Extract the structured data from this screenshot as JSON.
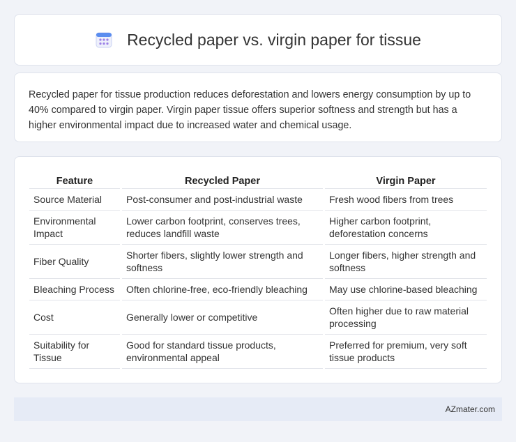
{
  "header": {
    "icon": "calendar-icon",
    "title": "Recycled paper vs. virgin paper for tissue"
  },
  "description": "Recycled paper for tissue production reduces deforestation and lowers energy consumption by up to 40% compared to virgin paper. Virgin paper tissue offers superior softness and strength but has a higher environmental impact due to increased water and chemical usage.",
  "table": {
    "headers": [
      "Feature",
      "Recycled Paper",
      "Virgin Paper"
    ],
    "rows": [
      [
        "Source Material",
        "Post-consumer and post-industrial waste",
        "Fresh wood fibers from trees"
      ],
      [
        "Environmental Impact",
        "Lower carbon footprint, conserves trees, reduces landfill waste",
        "Higher carbon footprint, deforestation concerns"
      ],
      [
        "Fiber Quality",
        "Shorter fibers, slightly lower strength and softness",
        "Longer fibers, higher strength and softness"
      ],
      [
        "Bleaching Process",
        "Often chlorine-free, eco-friendly bleaching",
        "May use chlorine-based bleaching"
      ],
      [
        "Cost",
        "Generally lower or competitive",
        "Often higher due to raw material processing"
      ],
      [
        "Suitability for Tissue",
        "Good for standard tissue products, environmental appeal",
        "Preferred for premium, very soft tissue products"
      ]
    ]
  },
  "footer": {
    "brand": "AZmater.com"
  },
  "colors": {
    "background": "#f1f3f8",
    "card": "#ffffff",
    "footer": "#e6ebf6",
    "icon_blue": "#5b8def",
    "icon_purple": "#9b7fe6"
  }
}
